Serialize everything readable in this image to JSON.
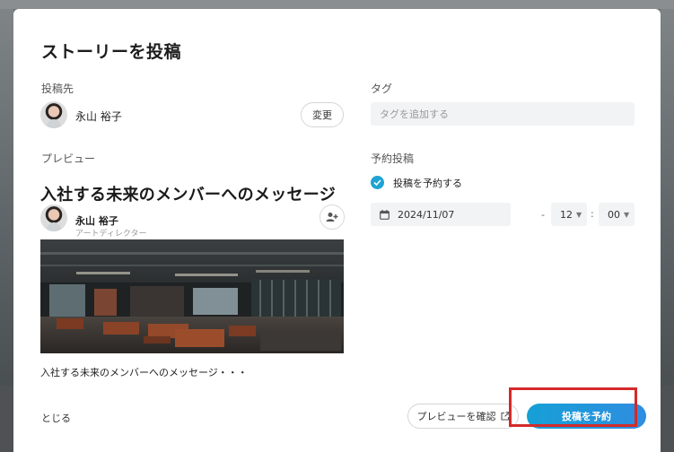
{
  "dialog": {
    "title": "ストーリーを投稿"
  },
  "destination": {
    "label": "投稿先",
    "user_name": "永山 裕子",
    "change_button": "変更"
  },
  "tags": {
    "label": "タグ",
    "placeholder": "タグを追加する"
  },
  "preview": {
    "label": "プレビュー",
    "title": "入社する未来のメンバーへのメッセージ",
    "author_name": "永山 裕子",
    "author_role": "アートディレクター",
    "caption": "入社する未来のメンバーへのメッセージ・・・"
  },
  "schedule": {
    "label": "予約投稿",
    "checkbox_label": "投稿を予約する",
    "checked": true,
    "date": "2024/11/07",
    "date_separator": "-",
    "hour": "12",
    "time_separator": ":",
    "minute": "00"
  },
  "footer": {
    "close_label": "とじる",
    "preview_button": "プレビューを確認",
    "submit_button": "投稿を予約"
  },
  "colors": {
    "accent": "#1ea3d4",
    "highlight_border": "#d42a2a"
  }
}
